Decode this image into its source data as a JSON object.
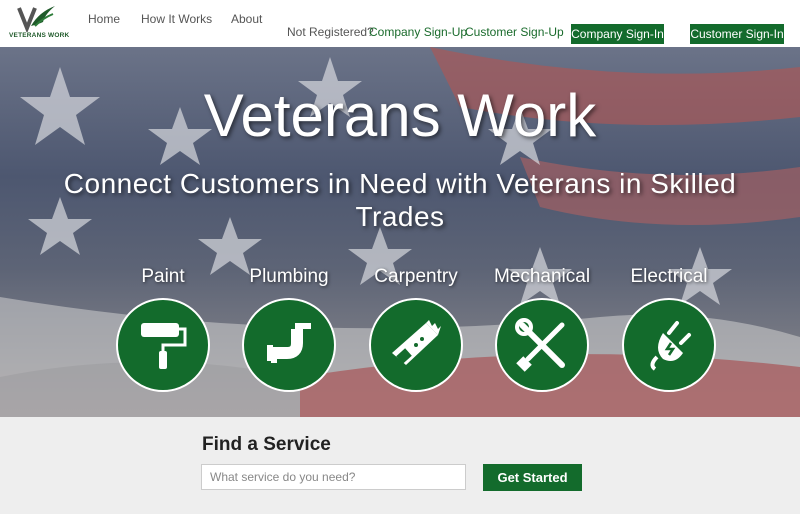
{
  "brand": {
    "logo_text": "VETERANS WORK",
    "color_primary": "#136b2c"
  },
  "nav": {
    "links": [
      "Home",
      "How It Works",
      "About"
    ],
    "not_registered": "Not Registered?",
    "company_signup": "Company Sign-Up",
    "customer_signup": "Customer Sign-Up",
    "company_signin": "Company Sign-In",
    "customer_signin": "Customer Sign-In"
  },
  "hero": {
    "title": "Veterans Work",
    "subtitle": "Connect Customers in Need with Veterans in Skilled Trades",
    "services": [
      {
        "label": "Paint",
        "icon": "paint-roller-icon"
      },
      {
        "label": "Plumbing",
        "icon": "pipe-icon"
      },
      {
        "label": "Carpentry",
        "icon": "saw-icon"
      },
      {
        "label": "Mechanical",
        "icon": "tools-icon"
      },
      {
        "label": "Electrical",
        "icon": "plug-icon"
      }
    ]
  },
  "find": {
    "title": "Find a Service",
    "placeholder": "What service do you need?",
    "button": "Get Started"
  }
}
